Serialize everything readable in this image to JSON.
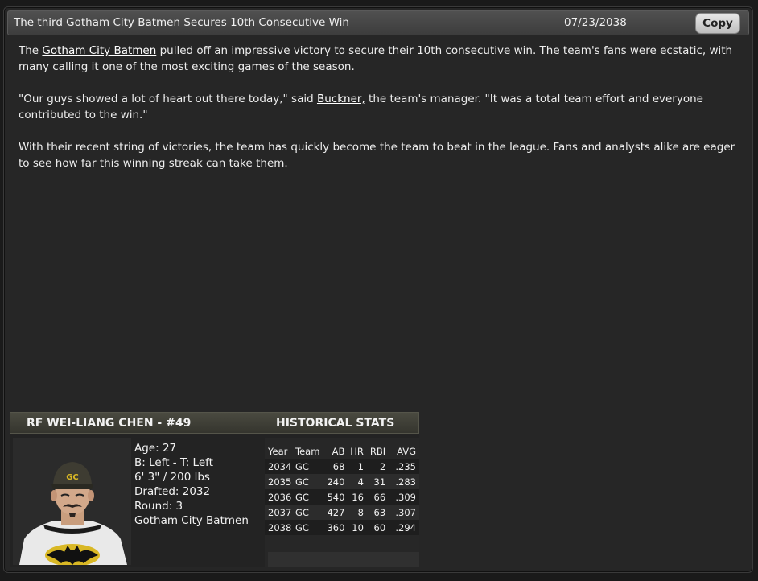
{
  "header": {
    "title": "The third Gotham City Batmen Secures 10th Consecutive Win",
    "date": "07/23/2038",
    "copy_label": "Copy"
  },
  "article": {
    "p1_pre": "The ",
    "p1_link": "Gotham City Batmen",
    "p1_post": " pulled off an impressive victory to secure their 10th consecutive win. The team's fans were ecstatic, with many calling it one of the most exciting games of the season.",
    "p2_pre": "\"Our guys showed a lot of heart out there today,\" said ",
    "p2_link": "Buckner,",
    "p2_post": " the team's manager. \"It was a total team effort and everyone contributed to the win.\"",
    "p3": "With their recent string of victories, the team has quickly become the team to beat in the league. Fans and analysts alike are eager to see how far this winning streak can take them."
  },
  "player": {
    "header_name": "RF WEI-LIANG CHEN - #49",
    "header_stats": "HISTORICAL STATS",
    "age": "Age: 27",
    "bats_throws": "B: Left - T: Left",
    "height_weight": "6' 3\" / 200 lbs",
    "drafted": "Drafted: 2032",
    "round": "Round: 3",
    "team": "Gotham City Batmen"
  },
  "stats": {
    "columns": [
      "Year",
      "Team",
      "AB",
      "HR",
      "RBI",
      "AVG"
    ],
    "rows": [
      [
        "2034",
        "GC",
        "68",
        "1",
        "2",
        ".235"
      ],
      [
        "2035",
        "GC",
        "240",
        "4",
        "31",
        ".283"
      ],
      [
        "2036",
        "GC",
        "540",
        "16",
        "66",
        ".309"
      ],
      [
        "2037",
        "GC",
        "427",
        "8",
        "63",
        ".307"
      ],
      [
        "2038",
        "GC",
        "360",
        "10",
        "60",
        ".294"
      ]
    ]
  },
  "colors": {
    "background": "#262626",
    "header_bar": "#454545",
    "player_header": "#3f3f36",
    "text": "#ededed"
  }
}
